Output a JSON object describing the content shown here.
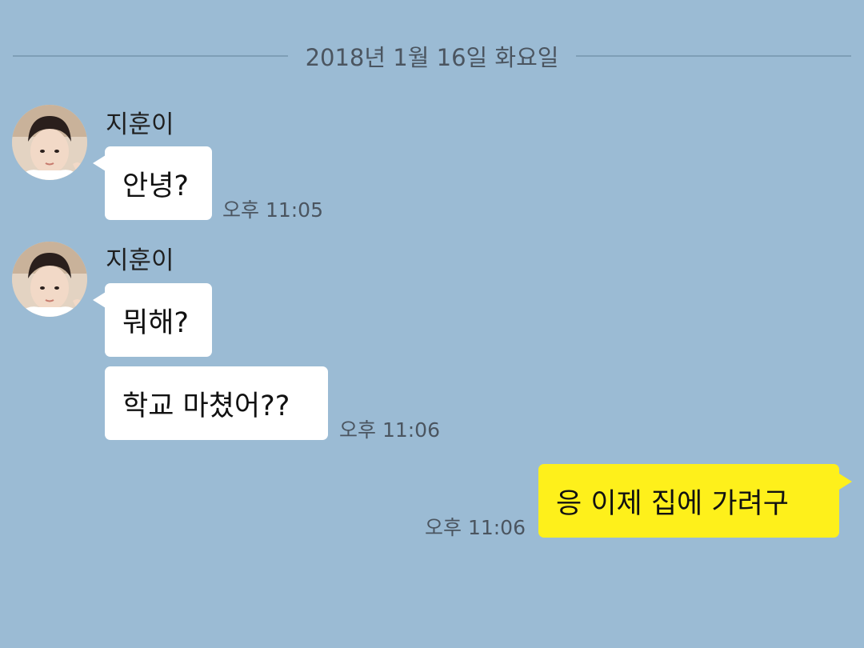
{
  "date_divider": "2018년 1월 16일 화요일",
  "messages": [
    {
      "sender": "지훈이",
      "text": "안녕?",
      "time": "오후 11:05"
    },
    {
      "sender": "지훈이",
      "text": "뭐해?",
      "time": ""
    },
    {
      "sender": "",
      "text": "학교 마쳤어??",
      "time": "오후 11:06"
    },
    {
      "sender": "me",
      "text": "응 이제 집에 가려구",
      "time": "오후 11:06"
    }
  ],
  "colors": {
    "background": "#9bbbd4",
    "incoming_bubble": "#ffffff",
    "outgoing_bubble": "#fef01b",
    "divider": "#7f9fb6"
  },
  "icons": {
    "avatar": "profile-photo"
  }
}
